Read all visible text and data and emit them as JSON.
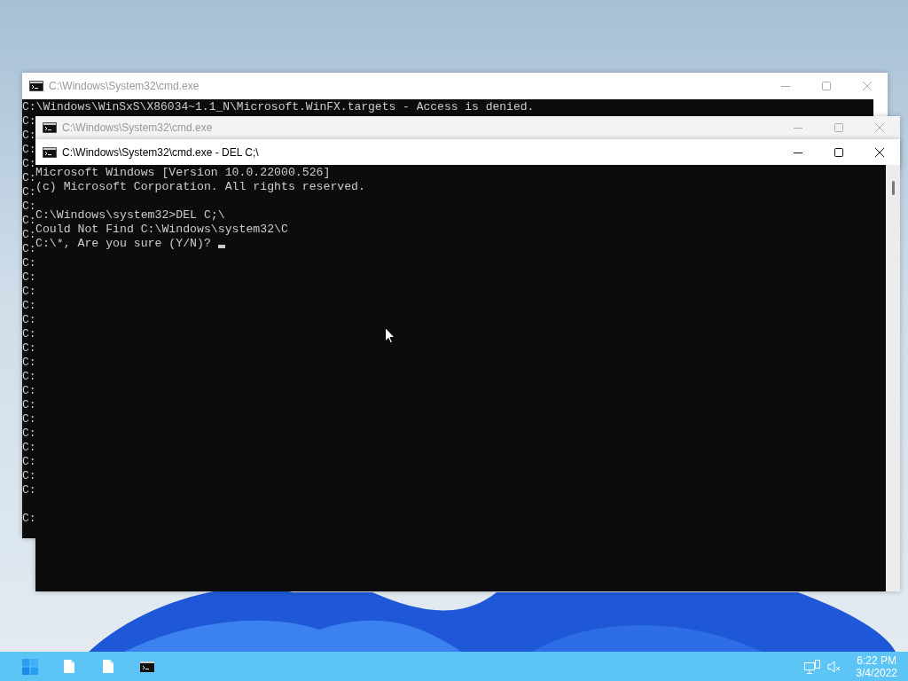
{
  "windows": [
    {
      "title": "C:\\Windows\\System32\\cmd.exe",
      "active": false,
      "blocks": [
        [
          "C:\\Windows\\WinSxS\\X86034~1.1_N\\Microsoft.WinFX.targets - Access is denied.",
          "C:",
          "C:",
          "C:",
          "C:",
          "C:",
          "C:",
          "C:",
          "C:",
          "C:",
          "C:",
          "C:",
          "C:",
          "C:",
          "C:",
          "C:",
          "C:",
          "C:",
          "C:",
          "C:",
          "C:",
          "C:",
          "C:",
          "C:",
          "C:",
          "C:",
          "C:",
          "C:"
        ],
        [
          "C:"
        ]
      ]
    },
    {
      "title": "C:\\Windows\\System32\\cmd.exe",
      "active": false
    },
    {
      "title": "C:\\Windows\\System32\\cmd.exe - DEL  C;\\",
      "active": true,
      "blocks": [
        [
          "Microsoft Windows [Version 10.0.22000.526]",
          "(c) Microsoft Corporation. All rights reserved."
        ],
        [
          "C:\\Windows\\system32>DEL C;\\",
          "Could Not Find C:\\Windows\\system32\\C",
          "C:\\*, Are you sure (Y/N)? "
        ]
      ],
      "cursor": true
    }
  ],
  "taskbar": {
    "apps": [
      {
        "kind": "start"
      },
      {
        "kind": "file"
      },
      {
        "kind": "file"
      },
      {
        "kind": "console"
      }
    ],
    "tray": {
      "time": "6:22 PM",
      "date": "3/4/2022"
    }
  }
}
